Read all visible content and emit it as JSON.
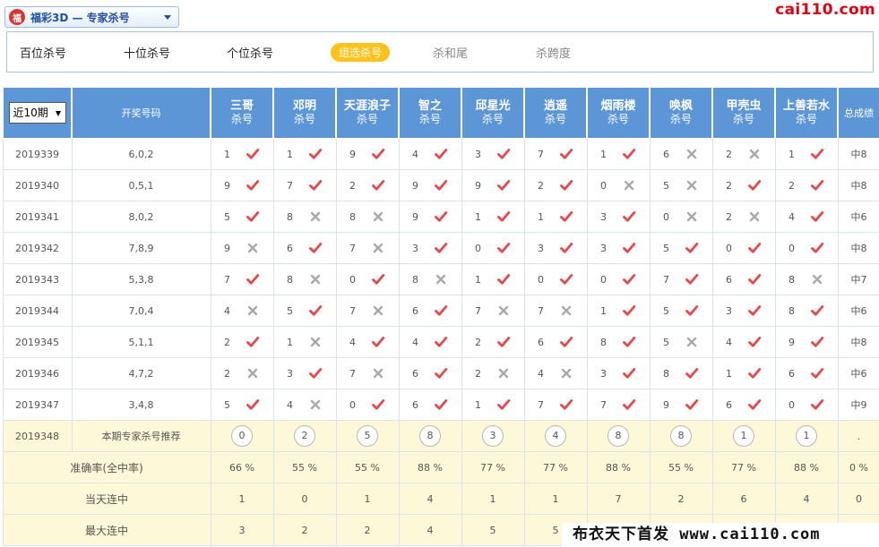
{
  "header": {
    "logo_glyph": "福",
    "lottery_title": "福彩3D — 专家杀号",
    "site_logo": "cai110.com"
  },
  "tabs": [
    {
      "label": "百位杀号",
      "state": "normal"
    },
    {
      "label": "十位杀号",
      "state": "normal"
    },
    {
      "label": "个位杀号",
      "state": "normal"
    },
    {
      "label": "组选杀号",
      "state": "active"
    },
    {
      "label": "杀和尾",
      "state": "muted"
    },
    {
      "label": "杀跨度",
      "state": "muted"
    }
  ],
  "table": {
    "period_select": "近10期",
    "col_draw": "开奖号码",
    "col_total": "总成绩",
    "experts": [
      {
        "name": "三哥",
        "sub": "杀号"
      },
      {
        "name": "邓明",
        "sub": "杀号"
      },
      {
        "name": "天涯浪子",
        "sub": "杀号"
      },
      {
        "name": "智之",
        "sub": "杀号"
      },
      {
        "name": "邱星光",
        "sub": "杀号"
      },
      {
        "name": "逍遥",
        "sub": "杀号"
      },
      {
        "name": "烟雨楼",
        "sub": "杀号"
      },
      {
        "name": "唤枫",
        "sub": "杀号"
      },
      {
        "name": "甲壳虫",
        "sub": "杀号"
      },
      {
        "name": "上善若水",
        "sub": "杀号"
      }
    ],
    "rows": [
      {
        "period": "2019339",
        "draw": "6,0,2",
        "total": "中8",
        "cells": [
          [
            "1",
            "hit"
          ],
          [
            "1",
            "hit"
          ],
          [
            "9",
            "hit"
          ],
          [
            "4",
            "hit"
          ],
          [
            "3",
            "hit"
          ],
          [
            "7",
            "hit"
          ],
          [
            "1",
            "hit"
          ],
          [
            "6",
            "miss"
          ],
          [
            "2",
            "miss"
          ],
          [
            "1",
            "hit"
          ]
        ]
      },
      {
        "period": "2019340",
        "draw": "0,5,1",
        "total": "中8",
        "cells": [
          [
            "9",
            "hit"
          ],
          [
            "7",
            "hit"
          ],
          [
            "2",
            "hit"
          ],
          [
            "9",
            "hit"
          ],
          [
            "9",
            "hit"
          ],
          [
            "2",
            "hit"
          ],
          [
            "0",
            "miss"
          ],
          [
            "5",
            "miss"
          ],
          [
            "2",
            "hit"
          ],
          [
            "2",
            "hit"
          ]
        ]
      },
      {
        "period": "2019341",
        "draw": "8,0,2",
        "total": "中6",
        "cells": [
          [
            "5",
            "hit"
          ],
          [
            "8",
            "miss"
          ],
          [
            "8",
            "miss"
          ],
          [
            "9",
            "hit"
          ],
          [
            "1",
            "hit"
          ],
          [
            "1",
            "hit"
          ],
          [
            "3",
            "hit"
          ],
          [
            "0",
            "miss"
          ],
          [
            "2",
            "miss"
          ],
          [
            "4",
            "hit"
          ]
        ]
      },
      {
        "period": "2019342",
        "draw": "7,8,9",
        "total": "中8",
        "cells": [
          [
            "9",
            "miss"
          ],
          [
            "6",
            "hit"
          ],
          [
            "7",
            "miss"
          ],
          [
            "3",
            "hit"
          ],
          [
            "0",
            "hit"
          ],
          [
            "3",
            "hit"
          ],
          [
            "3",
            "hit"
          ],
          [
            "5",
            "hit"
          ],
          [
            "0",
            "hit"
          ],
          [
            "0",
            "hit"
          ]
        ]
      },
      {
        "period": "2019343",
        "draw": "5,3,8",
        "total": "中7",
        "cells": [
          [
            "7",
            "hit"
          ],
          [
            "8",
            "miss"
          ],
          [
            "0",
            "hit"
          ],
          [
            "8",
            "miss"
          ],
          [
            "1",
            "hit"
          ],
          [
            "0",
            "hit"
          ],
          [
            "0",
            "hit"
          ],
          [
            "7",
            "hit"
          ],
          [
            "6",
            "hit"
          ],
          [
            "8",
            "miss"
          ]
        ]
      },
      {
        "period": "2019344",
        "draw": "7,0,4",
        "total": "中6",
        "cells": [
          [
            "4",
            "miss"
          ],
          [
            "5",
            "hit"
          ],
          [
            "7",
            "miss"
          ],
          [
            "6",
            "hit"
          ],
          [
            "7",
            "miss"
          ],
          [
            "7",
            "miss"
          ],
          [
            "1",
            "hit"
          ],
          [
            "5",
            "hit"
          ],
          [
            "3",
            "hit"
          ],
          [
            "8",
            "hit"
          ]
        ]
      },
      {
        "period": "2019345",
        "draw": "5,1,1",
        "total": "中8",
        "cells": [
          [
            "2",
            "hit"
          ],
          [
            "1",
            "miss"
          ],
          [
            "4",
            "hit"
          ],
          [
            "4",
            "hit"
          ],
          [
            "2",
            "hit"
          ],
          [
            "6",
            "hit"
          ],
          [
            "8",
            "hit"
          ],
          [
            "5",
            "miss"
          ],
          [
            "4",
            "hit"
          ],
          [
            "9",
            "hit"
          ]
        ]
      },
      {
        "period": "2019346",
        "draw": "4,7,2",
        "total": "中6",
        "cells": [
          [
            "2",
            "miss"
          ],
          [
            "3",
            "hit"
          ],
          [
            "7",
            "miss"
          ],
          [
            "6",
            "hit"
          ],
          [
            "2",
            "miss"
          ],
          [
            "4",
            "miss"
          ],
          [
            "3",
            "hit"
          ],
          [
            "8",
            "hit"
          ],
          [
            "1",
            "hit"
          ],
          [
            "6",
            "hit"
          ]
        ]
      },
      {
        "period": "2019347",
        "draw": "3,4,8",
        "total": "中9",
        "cells": [
          [
            "5",
            "hit"
          ],
          [
            "4",
            "miss"
          ],
          [
            "0",
            "hit"
          ],
          [
            "6",
            "hit"
          ],
          [
            "1",
            "hit"
          ],
          [
            "7",
            "hit"
          ],
          [
            "7",
            "hit"
          ],
          [
            "9",
            "hit"
          ],
          [
            "6",
            "hit"
          ],
          [
            "0",
            "hit"
          ]
        ]
      }
    ],
    "recommend": {
      "period": "2019348",
      "label": "本期专家杀号推荐",
      "balls": [
        "0",
        "2",
        "5",
        "8",
        "3",
        "4",
        "8",
        "8",
        "1",
        "1"
      ],
      "total": "."
    },
    "stats": [
      {
        "label": "准确率(全中率)",
        "values": [
          "66 %",
          "55 %",
          "55 %",
          "88 %",
          "77 %",
          "77 %",
          "88 %",
          "55 %",
          "77 %",
          "88 %"
        ],
        "total": "0 %"
      },
      {
        "label": "当天连中",
        "values": [
          "1",
          "0",
          "1",
          "4",
          "1",
          "1",
          "7",
          "2",
          "6",
          "4"
        ],
        "total": "0"
      },
      {
        "label": "最大连中",
        "values": [
          "3",
          "2",
          "2",
          "4",
          "5",
          "5",
          "",
          "",
          "",
          ""
        ],
        "total": ""
      }
    ]
  },
  "marks": {
    "hit_color": "#e8474c",
    "miss_color": "#a9a9a9"
  },
  "watermark": "布衣天下首发 www.cai110.com"
}
